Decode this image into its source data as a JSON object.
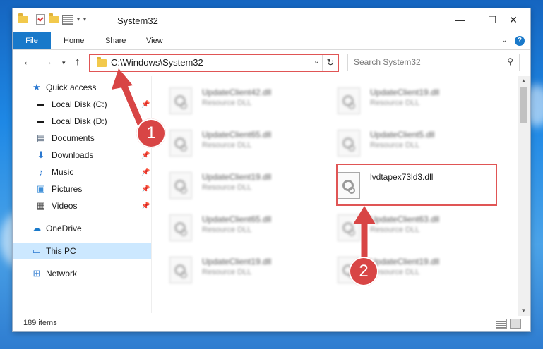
{
  "window": {
    "title": "System32",
    "controls": {
      "minimize": "—",
      "maximize": "☐",
      "close": "✕"
    }
  },
  "ribbon": {
    "tabs": [
      "File",
      "Home",
      "Share",
      "View"
    ]
  },
  "address": {
    "path": "C:\\Windows\\System32",
    "search_placeholder": "Search System32"
  },
  "sidebar": {
    "items": [
      {
        "label": "Quick access",
        "icon": "star-icon",
        "pinned": false
      },
      {
        "label": "Local Disk (C:)",
        "icon": "drive-icon",
        "pinned": true
      },
      {
        "label": "Local Disk (D:)",
        "icon": "drive-icon",
        "pinned": false
      },
      {
        "label": "Documents",
        "icon": "documents-icon",
        "pinned": true
      },
      {
        "label": "Downloads",
        "icon": "download-icon",
        "pinned": true
      },
      {
        "label": "Music",
        "icon": "music-icon",
        "pinned": true
      },
      {
        "label": "Pictures",
        "icon": "pictures-icon",
        "pinned": true
      },
      {
        "label": "Videos",
        "icon": "videos-icon",
        "pinned": true
      },
      {
        "label": "OneDrive",
        "icon": "cloud-icon",
        "pinned": false
      },
      {
        "label": "This PC",
        "icon": "pc-icon",
        "pinned": false,
        "selected": true
      },
      {
        "label": "Network",
        "icon": "network-icon",
        "pinned": false
      }
    ]
  },
  "files": [
    {
      "name": "UpdateClient42.dll",
      "type": "Resource DLL",
      "blurred": true
    },
    {
      "name": "UpdateClient19.dll",
      "type": "Resource DLL",
      "blurred": true
    },
    {
      "name": "UpdateClient65.dll",
      "type": "Resource DLL",
      "blurred": true
    },
    {
      "name": "UpdateClient5.dll",
      "type": "Resource DLL",
      "blurred": true
    },
    {
      "name": "UpdateClient19.dll",
      "type": "Resource DLL",
      "blurred": true
    },
    {
      "name": "lvdtapex73ld3.dll",
      "type": "",
      "blurred": false
    },
    {
      "name": "UpdateClient65.dll",
      "type": "Resource DLL",
      "blurred": true
    },
    {
      "name": "UpdateClient63.dll",
      "type": "Resource DLL",
      "blurred": true
    },
    {
      "name": "UpdateClient19.dll",
      "type": "Resource DLL",
      "blurred": true
    },
    {
      "name": "UpdateClient19.dll",
      "type": "Resource DLL",
      "blurred": true
    }
  ],
  "status": {
    "item_count": "189 items"
  },
  "annotations": {
    "marker1": "1",
    "marker2": "2"
  },
  "colors": {
    "highlight": "#e05555",
    "accent": "#1979ca",
    "selected": "#cce8ff"
  }
}
